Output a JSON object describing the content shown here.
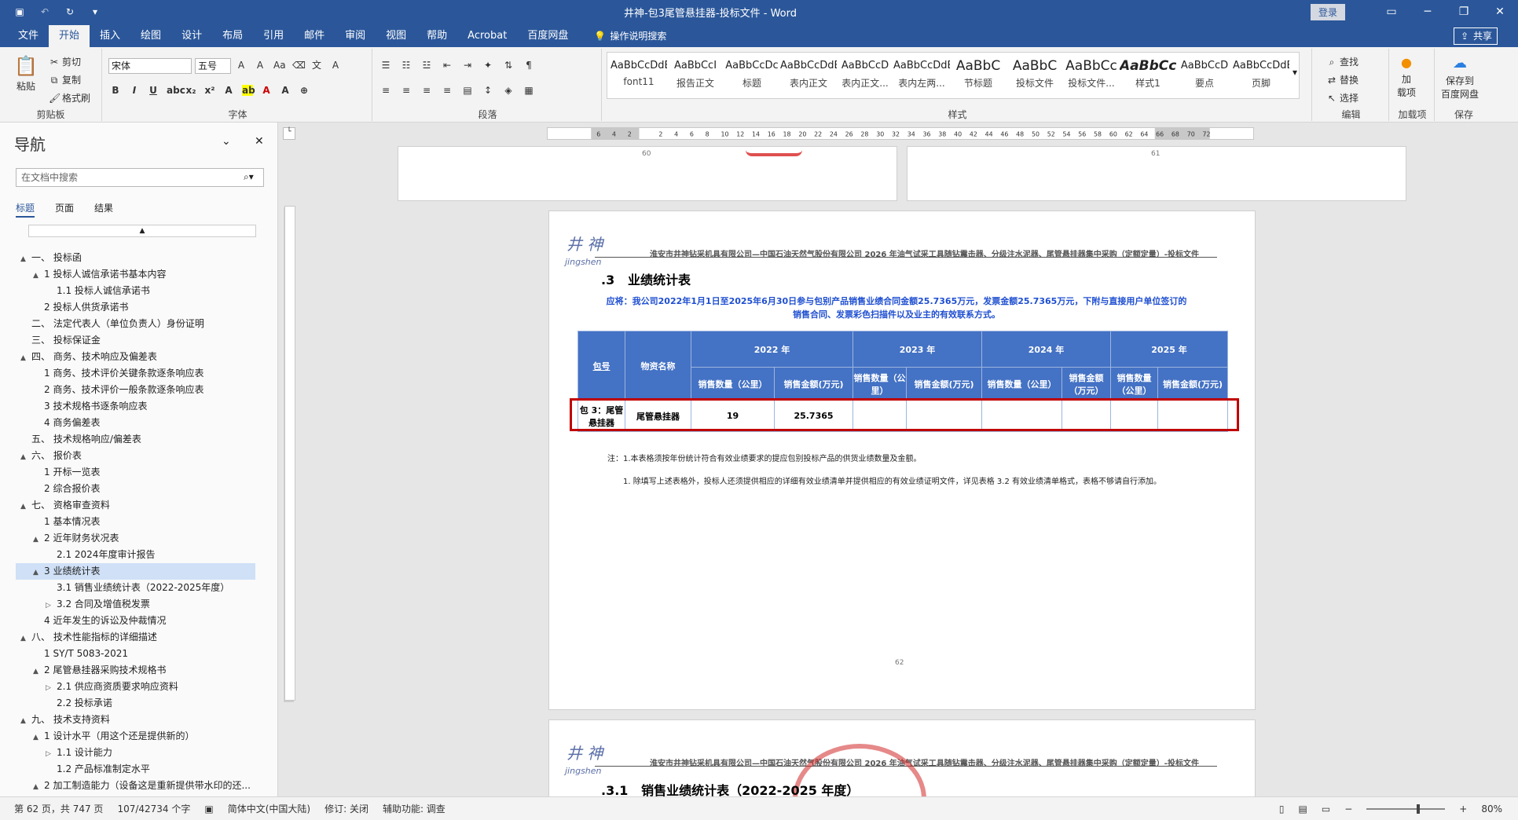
{
  "window": {
    "title": "井神-包3尾管悬挂器-投标文件 - Word",
    "login_label": "登录",
    "qat_icons": [
      "save-icon",
      "undo-icon",
      "redo-icon",
      "customize-icon"
    ]
  },
  "ribbon_tabs": [
    "文件",
    "开始",
    "插入",
    "绘图",
    "设计",
    "布局",
    "引用",
    "邮件",
    "审阅",
    "视图",
    "帮助",
    "Acrobat",
    "百度网盘"
  ],
  "active_tab": "开始",
  "tell_me": "操作说明搜索",
  "share_label": "共享",
  "clipboard": {
    "paste": "粘贴",
    "cut": "剪切",
    "copy": "复制",
    "format_painter": "格式刷",
    "group": "剪贴板"
  },
  "font": {
    "family": "宋体",
    "size": "五号",
    "group": "字体"
  },
  "paragraph": {
    "group": "段落"
  },
  "styles": {
    "group": "样式",
    "items": [
      {
        "sample": "AaBbCcDdEe",
        "name": "font11"
      },
      {
        "sample": "AaBbCcI",
        "name": "报告正文"
      },
      {
        "sample": "AaBbCcDc",
        "name": "标题"
      },
      {
        "sample": "AaBbCcDdE",
        "name": "表内正文"
      },
      {
        "sample": "AaBbCcD",
        "name": "表内正文..."
      },
      {
        "sample": "AaBbCcDdEe",
        "name": "表内左两..."
      },
      {
        "sample": "AaBbC",
        "name": "节标题"
      },
      {
        "sample": "AaBbC",
        "name": "投标文件"
      },
      {
        "sample": "AaBbCc",
        "name": "投标文件..."
      },
      {
        "sample": "AaBbCc",
        "name": "样式1"
      },
      {
        "sample": "AaBbCcD",
        "name": "要点"
      },
      {
        "sample": "AaBbCcDdE",
        "name": "页脚"
      }
    ]
  },
  "editing": {
    "find": "查找",
    "replace": "替换",
    "select": "选择",
    "group": "编辑"
  },
  "addins": {
    "label": "加\n载项",
    "group": "加载项"
  },
  "save_cloud": {
    "label": "保存到\n百度网盘",
    "group": "保存"
  },
  "nav": {
    "title": "导航",
    "search_placeholder": "在文档中搜索",
    "tabs": [
      "标题",
      "页面",
      "结果"
    ],
    "items": [
      {
        "level": 1,
        "text": "一、 投标函",
        "exp": "▲"
      },
      {
        "level": 2,
        "text": "1 投标人诚信承诺书基本内容",
        "exp": "▲"
      },
      {
        "level": 3,
        "text": "1.1 投标人诚信承诺书",
        "exp": ""
      },
      {
        "level": 2,
        "text": "2 投标人供货承诺书",
        "exp": ""
      },
      {
        "level": 1,
        "text": "二、 法定代表人（单位负责人）身份证明",
        "exp": ""
      },
      {
        "level": 1,
        "text": "三、 投标保证金",
        "exp": ""
      },
      {
        "level": 1,
        "text": "四、 商务、技术响应及偏差表",
        "exp": "▲"
      },
      {
        "level": 2,
        "text": "1 商务、技术评价关键条款逐条响应表",
        "exp": ""
      },
      {
        "level": 2,
        "text": "2 商务、技术评价一般条款逐条响应表",
        "exp": ""
      },
      {
        "level": 2,
        "text": "3 技术规格书逐条响应表",
        "exp": ""
      },
      {
        "level": 2,
        "text": "4 商务偏差表",
        "exp": ""
      },
      {
        "level": 1,
        "text": "五、 技术规格响应/偏差表",
        "exp": ""
      },
      {
        "level": 1,
        "text": "六、 报价表",
        "exp": "▲"
      },
      {
        "level": 2,
        "text": "1 开标一览表",
        "exp": ""
      },
      {
        "level": 2,
        "text": "2 综合报价表",
        "exp": ""
      },
      {
        "level": 1,
        "text": "七、 资格审查资料",
        "exp": "▲"
      },
      {
        "level": 2,
        "text": "1 基本情况表",
        "exp": ""
      },
      {
        "level": 2,
        "text": "2 近年财务状况表",
        "exp": "▲"
      },
      {
        "level": 3,
        "text": "2.1 2024年度审计报告",
        "exp": ""
      },
      {
        "level": 2,
        "text": "3 业绩统计表",
        "exp": "▲",
        "selected": true
      },
      {
        "level": 3,
        "text": "3.1 销售业绩统计表（2022-2025年度）",
        "exp": ""
      },
      {
        "level": 3,
        "text": "3.2 合同及增值税发票",
        "exp": "▷"
      },
      {
        "level": 2,
        "text": "4 近年发生的诉讼及仲裁情况",
        "exp": ""
      },
      {
        "level": 1,
        "text": "八、 技术性能指标的详细描述",
        "exp": "▲"
      },
      {
        "level": 2,
        "text": "1 SY/T 5083-2021",
        "exp": ""
      },
      {
        "level": 2,
        "text": "2 尾管悬挂器采购技术规格书",
        "exp": "▲"
      },
      {
        "level": 3,
        "text": "2.1 供应商资质要求响应资料",
        "exp": "▷"
      },
      {
        "level": 3,
        "text": "2.2 投标承诺",
        "exp": ""
      },
      {
        "level": 1,
        "text": "九、 技术支持资料",
        "exp": "▲"
      },
      {
        "level": 2,
        "text": "1 设计水平（用这个还是提供新的）",
        "exp": "▲"
      },
      {
        "level": 3,
        "text": "1.1 设计能力",
        "exp": "▷"
      },
      {
        "level": 3,
        "text": "1.2 产品标准制定水平",
        "exp": ""
      },
      {
        "level": 2,
        "text": "2 加工制造能力（设备这是重新提供带水印的还...",
        "exp": "▲"
      }
    ]
  },
  "ruler_labels": [
    "6",
    "4",
    "2",
    "",
    "2",
    "4",
    "6",
    "8",
    "10",
    "12",
    "14",
    "16",
    "18",
    "20",
    "22",
    "24",
    "26",
    "28",
    "30",
    "32",
    "34",
    "36",
    "38",
    "40",
    "42",
    "44",
    "46",
    "48",
    "50",
    "52",
    "54",
    "56",
    "58",
    "60",
    "62",
    "64",
    "66",
    "68",
    "70",
    "72"
  ],
  "pages_top": {
    "left_number": "60",
    "right_number": "61"
  },
  "page": {
    "logo_main": "井 神",
    "logo_sub": "jingshen",
    "header": "淮安市井神钻采机具有限公司—中国石油天然气股份有限公司 2026 年油气试采工具随钻震击器、分级注水泥器、尾管悬挂器集中采购（定额定量）-投标文件",
    "heading_num": ".3",
    "heading": "业绩统计表",
    "statement": "应将：我公司2022年1月1日至2025年6月30日参与包别产品销售业绩合同金额25.7365万元，发票金额25.7365万元，下附与直接用户单位签订的销售合同、发票彩色扫描件以及业主的有效联系方式。",
    "table": {
      "col_pkg": "包号",
      "col_name": "物资名称",
      "years": [
        "2022 年",
        "2023 年",
        "2024 年",
        "2025 年"
      ],
      "sub": [
        "销售数量（公里）",
        "销售金额(万元)",
        "销售数量（公里）",
        "销售金额(万元)",
        "销售数量（公里）",
        "销售金额（万元）",
        "销售数量（公里）",
        "销售金额(万元)"
      ],
      "row": {
        "pkg": "包 3：尾管悬挂器",
        "name": "尾管悬挂器",
        "vals": [
          "19",
          "25.7365",
          "",
          "",
          "",
          "",
          "",
          ""
        ]
      }
    },
    "note1": "注：1.本表格须按年份统计符合有效业绩要求的提应包别投标产品的供货业绩数量及金额。",
    "note2": "1. 除填写上述表格外，投标人还须提供相应的详细有效业绩清单并提供相应的有效业绩证明文件，详见表格 3.2 有效业绩清单格式，表格不够请自行添加。",
    "page_number": "62"
  },
  "next_page": {
    "heading_num": ".3.1",
    "heading": "销售业绩统计表（2022-2025 年度）"
  },
  "status": {
    "page": "第 62 页，共 747 页",
    "words": "107/42734 个字",
    "lang": "简体中文(中国大陆)",
    "track": "修订: 关闭",
    "access": "辅助功能: 调查",
    "zoom": "80%"
  },
  "colors": {
    "brand": "#2b579a",
    "table_header": "#4472c4",
    "highlight_box": "#c00000",
    "blue_text": "#1f4fd1"
  }
}
